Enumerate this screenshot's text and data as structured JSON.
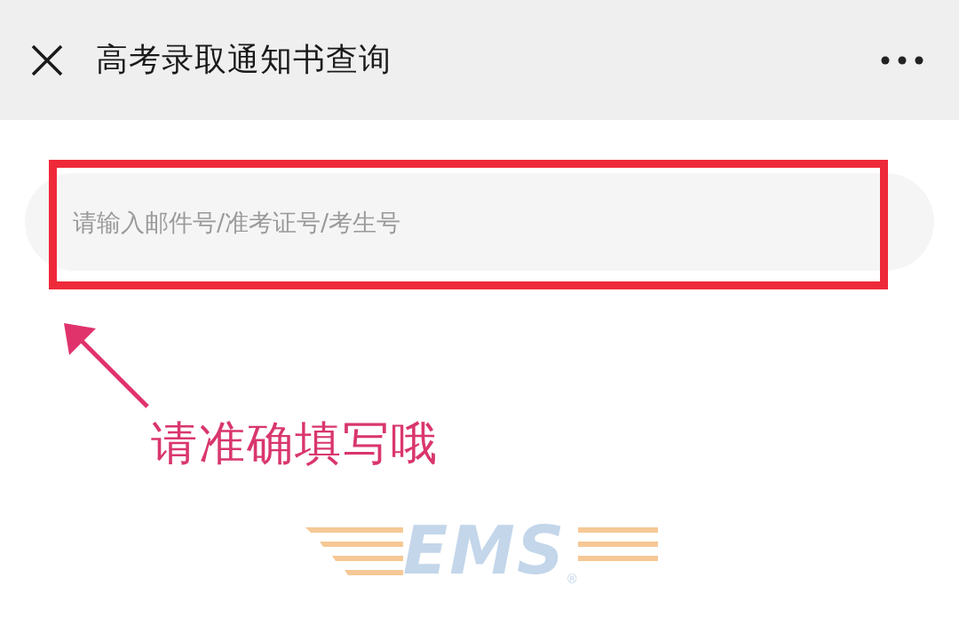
{
  "header": {
    "title": "高考录取通知书查询"
  },
  "search_field": {
    "placeholder": "请输入邮件号/准考证号/考生号"
  },
  "annotation": {
    "text": "请准确填写哦"
  },
  "logo": {
    "text": "EMS",
    "mark": "®"
  }
}
